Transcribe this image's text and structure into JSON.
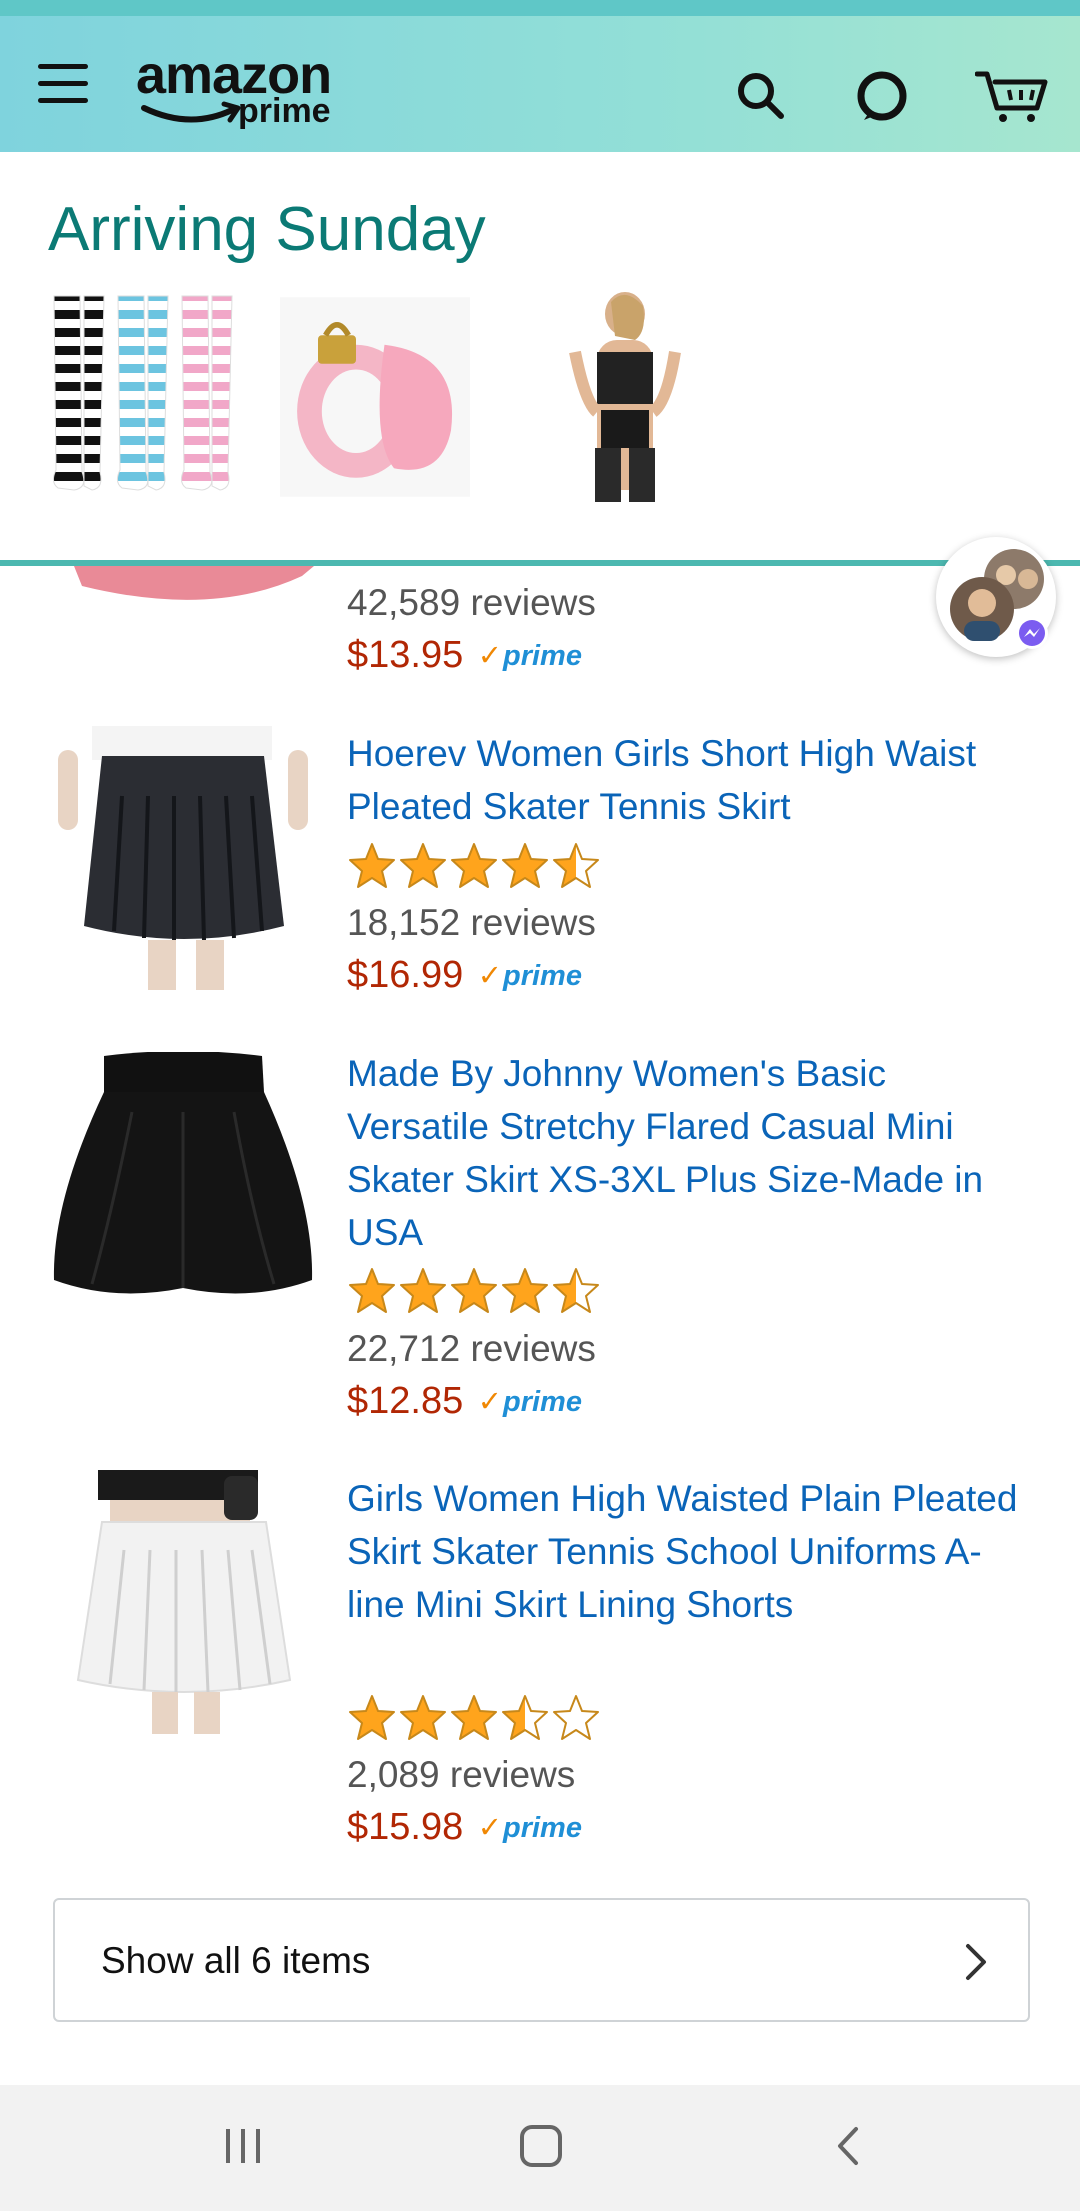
{
  "header": {
    "logo_main": "amazon",
    "logo_sub": "prime",
    "icons": [
      "menu-icon",
      "search-icon",
      "alexa-icon",
      "cart-icon"
    ],
    "background_colors": [
      "#7fd3dd",
      "#a6e6cf"
    ]
  },
  "arriving": {
    "title": "Arriving Sunday",
    "title_color": "#0b7a75",
    "thumbnails": [
      "striped-socks-image",
      "pink-lock-device-image",
      "black-lingerie-image"
    ]
  },
  "products": [
    {
      "title": "",
      "reviews": "42,589 reviews",
      "price": "$13.95",
      "prime": "prime",
      "rating": null
    },
    {
      "title": "Hoerev Women Girls Short High Waist Pleated Skater Tennis Skirt",
      "rating": 4.5,
      "reviews": "18,152 reviews",
      "price": "$16.99",
      "prime": "prime"
    },
    {
      "title": "Made By Johnny Women's Basic Versatile Stretchy Flared Casual Mini Skater Skirt XS-3XL Plus Size-Made in USA",
      "rating": 4.5,
      "reviews": "22,712 reviews",
      "price": "$12.85",
      "prime": "prime"
    },
    {
      "title": "Girls Women High Waisted Plain Pleated Skirt Skater Tennis School Uniforms A-line Mini Skirt Lining Shorts",
      "rating": 3.5,
      "reviews": "2,089 reviews",
      "price": "$15.98",
      "prime": "prime"
    }
  ],
  "show_all": {
    "label": "Show all 6 items"
  },
  "colors": {
    "link": "#0a64b8",
    "price": "#b12704",
    "prime": "#1f8fd6",
    "star": "#ffa41c"
  },
  "navbar": {
    "icons": [
      "recent-apps-icon",
      "home-icon",
      "back-icon"
    ]
  }
}
